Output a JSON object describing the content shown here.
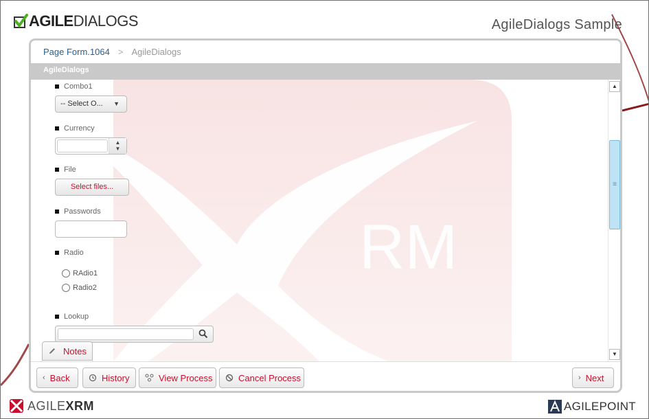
{
  "header": {
    "logo_text_bold": "AGILE",
    "logo_text_light": "DIALOGS",
    "app_title": "AgileDialogs Sample"
  },
  "breadcrumb": {
    "link": "Page Form.1064",
    "separator": ">",
    "current": "AgileDialogs"
  },
  "section_title": "AgileDialogs",
  "watermark_text": "RM",
  "form": {
    "combo": {
      "label": "Combo1",
      "value": "-- Select O..."
    },
    "currency": {
      "label": "Currency",
      "value": ""
    },
    "file": {
      "label": "File",
      "button": "Select files..."
    },
    "passwords": {
      "label": "Passwords",
      "value": ""
    },
    "radio": {
      "label": "Radio",
      "options": [
        "RAdio1",
        "Radio2"
      ]
    },
    "lookup": {
      "label": "Lookup",
      "value": ""
    }
  },
  "notes_label": "Notes",
  "footer": {
    "back": "Back",
    "history": "History",
    "view_process": "View Process",
    "cancel_process": "Cancel Process",
    "next": "Next"
  },
  "bottom": {
    "left_logo_light": "AGILE",
    "left_logo_bold": "XRM",
    "right_logo": "AGILEPOINT"
  },
  "colors": {
    "accent_red": "#c8102e",
    "link_blue": "#2a5f8f",
    "scroll_thumb": "#bde3f5"
  }
}
